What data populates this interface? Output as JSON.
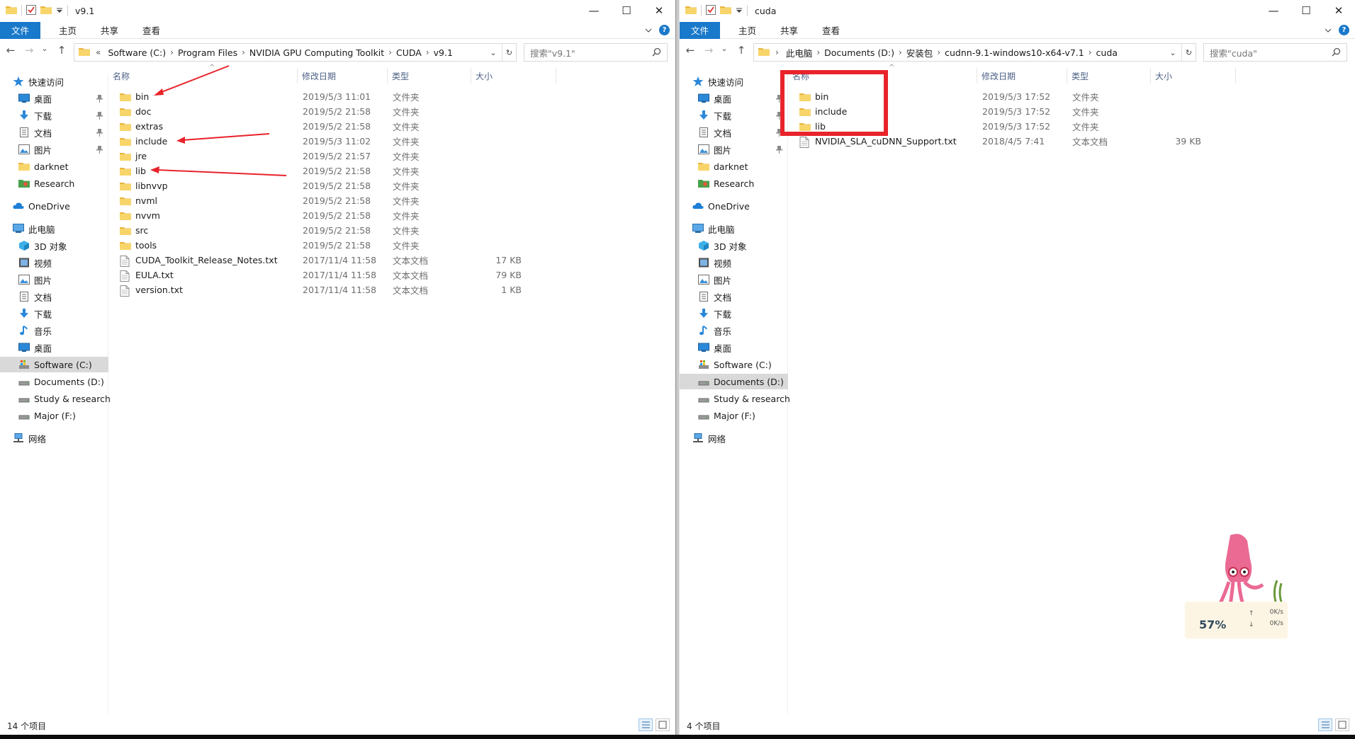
{
  "left": {
    "title": "v9.1",
    "ribbon": [
      "文件",
      "主页",
      "共享",
      "查看"
    ],
    "breadcrumb": [
      "Software (C:)",
      "Program Files",
      "NVIDIA GPU Computing Toolkit",
      "CUDA",
      "v9.1"
    ],
    "breadcrumb_prefix": "«",
    "search_placeholder": "搜索\"v9.1\"",
    "columns": [
      "名称",
      "修改日期",
      "类型",
      "大小"
    ],
    "files": [
      {
        "name": "bin",
        "date": "2019/5/3 11:01",
        "type": "文件夹",
        "size": "",
        "kind": "folder"
      },
      {
        "name": "doc",
        "date": "2019/5/2 21:58",
        "type": "文件夹",
        "size": "",
        "kind": "folder"
      },
      {
        "name": "extras",
        "date": "2019/5/2 21:58",
        "type": "文件夹",
        "size": "",
        "kind": "folder"
      },
      {
        "name": "include",
        "date": "2019/5/3 11:02",
        "type": "文件夹",
        "size": "",
        "kind": "folder"
      },
      {
        "name": "jre",
        "date": "2019/5/2 21:57",
        "type": "文件夹",
        "size": "",
        "kind": "folder"
      },
      {
        "name": "lib",
        "date": "2019/5/2 21:58",
        "type": "文件夹",
        "size": "",
        "kind": "folder"
      },
      {
        "name": "libnvvp",
        "date": "2019/5/2 21:58",
        "type": "文件夹",
        "size": "",
        "kind": "folder"
      },
      {
        "name": "nvml",
        "date": "2019/5/2 21:58",
        "type": "文件夹",
        "size": "",
        "kind": "folder"
      },
      {
        "name": "nvvm",
        "date": "2019/5/2 21:58",
        "type": "文件夹",
        "size": "",
        "kind": "folder"
      },
      {
        "name": "src",
        "date": "2019/5/2 21:58",
        "type": "文件夹",
        "size": "",
        "kind": "folder"
      },
      {
        "name": "tools",
        "date": "2019/5/2 21:58",
        "type": "文件夹",
        "size": "",
        "kind": "folder"
      },
      {
        "name": "CUDA_Toolkit_Release_Notes.txt",
        "date": "2017/11/4 11:58",
        "type": "文本文档",
        "size": "17 KB",
        "kind": "file"
      },
      {
        "name": "EULA.txt",
        "date": "2017/11/4 11:58",
        "type": "文本文档",
        "size": "79 KB",
        "kind": "file"
      },
      {
        "name": "version.txt",
        "date": "2017/11/4 11:58",
        "type": "文本文档",
        "size": "1 KB",
        "kind": "file"
      }
    ],
    "status": "14 个项目",
    "selected_nav": "Software (C:)"
  },
  "right": {
    "title": "cuda",
    "ribbon": [
      "文件",
      "主页",
      "共享",
      "查看"
    ],
    "breadcrumb": [
      "此电脑",
      "Documents (D:)",
      "安装包",
      "cudnn-9.1-windows10-x64-v7.1",
      "cuda"
    ],
    "breadcrumb_prefix": "",
    "search_placeholder": "搜索\"cuda\"",
    "columns": [
      "名称",
      "修改日期",
      "类型",
      "大小"
    ],
    "files": [
      {
        "name": "bin",
        "date": "2019/5/3 17:52",
        "type": "文件夹",
        "size": "",
        "kind": "folder"
      },
      {
        "name": "include",
        "date": "2019/5/3 17:52",
        "type": "文件夹",
        "size": "",
        "kind": "folder"
      },
      {
        "name": "lib",
        "date": "2019/5/3 17:52",
        "type": "文件夹",
        "size": "",
        "kind": "folder"
      },
      {
        "name": "NVIDIA_SLA_cuDNN_Support.txt",
        "date": "2018/4/5 7:41",
        "type": "文本文档",
        "size": "39 KB",
        "kind": "file"
      }
    ],
    "status": "4 个项目",
    "selected_nav": "Documents (D:)"
  },
  "nav": [
    {
      "label": "快速访问",
      "icon": "star-icon",
      "level": 0,
      "pinned": false
    },
    {
      "label": "桌面",
      "icon": "desktop-icon",
      "level": 1,
      "pinned": true
    },
    {
      "label": "下载",
      "icon": "download-icon",
      "level": 1,
      "pinned": true
    },
    {
      "label": "文档",
      "icon": "document-icon",
      "level": 1,
      "pinned": true
    },
    {
      "label": "图片",
      "icon": "picture-icon",
      "level": 1,
      "pinned": true
    },
    {
      "label": "darknet",
      "icon": "folder-icon",
      "level": 1,
      "pinned": false
    },
    {
      "label": "Research",
      "icon": "research-icon",
      "level": 1,
      "pinned": false
    },
    {
      "label": "OneDrive",
      "icon": "cloud-icon",
      "level": 0,
      "pinned": false
    },
    {
      "label": "此电脑",
      "icon": "pc-icon",
      "level": 0,
      "pinned": false
    },
    {
      "label": "3D 对象",
      "icon": "cube-icon",
      "level": 1,
      "pinned": false
    },
    {
      "label": "视频",
      "icon": "video-icon",
      "level": 1,
      "pinned": false
    },
    {
      "label": "图片",
      "icon": "picture-icon",
      "level": 1,
      "pinned": false
    },
    {
      "label": "文档",
      "icon": "document-icon",
      "level": 1,
      "pinned": false
    },
    {
      "label": "下载",
      "icon": "download-icon",
      "level": 1,
      "pinned": false
    },
    {
      "label": "音乐",
      "icon": "music-icon",
      "level": 1,
      "pinned": false
    },
    {
      "label": "桌面",
      "icon": "desktop-icon",
      "level": 1,
      "pinned": false
    },
    {
      "label": "Software (C:)",
      "icon": "system-drive-icon",
      "level": 1,
      "pinned": false
    },
    {
      "label": "Documents (D:)",
      "icon": "drive-icon",
      "level": 1,
      "pinned": false
    },
    {
      "label": "Study & research",
      "icon": "drive-icon",
      "level": 1,
      "pinned": false
    },
    {
      "label": "Major (F:)",
      "icon": "drive-icon",
      "level": 1,
      "pinned": false
    },
    {
      "label": "网络",
      "icon": "network-icon",
      "level": 0,
      "pinned": false
    }
  ],
  "widget": {
    "percent": "57%",
    "up": "0K/s",
    "down": "0K/s"
  },
  "colors": {
    "accent": "#1979ca",
    "folder": "#f8d56b",
    "annotation": "#e8232b"
  }
}
